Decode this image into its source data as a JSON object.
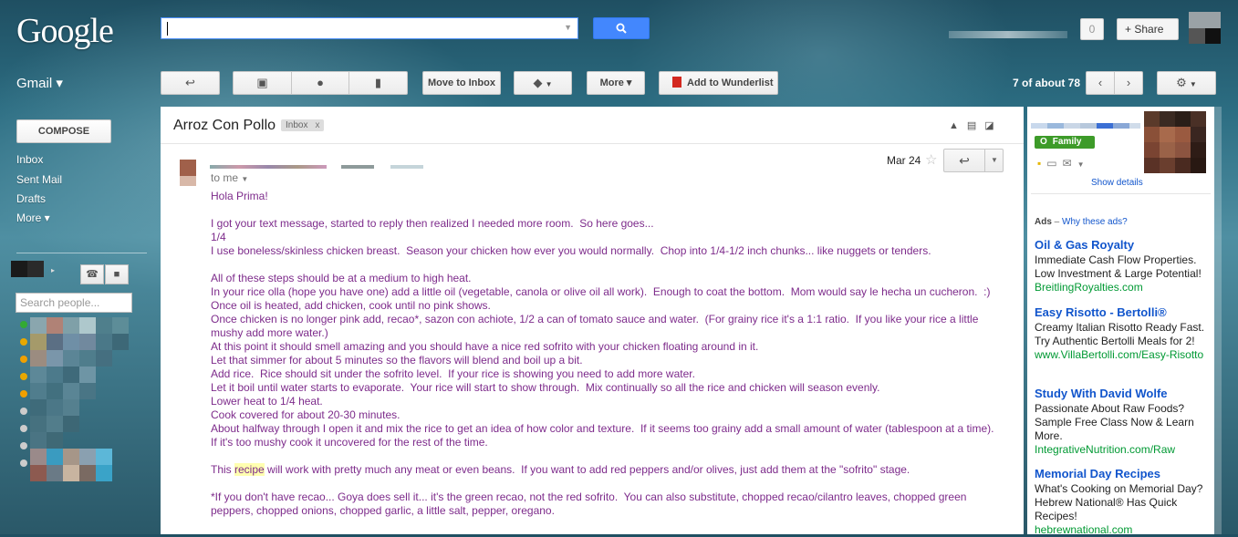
{
  "header": {
    "logo": "Google",
    "notifications_count": "0",
    "share_label": "+ Share"
  },
  "toolbar": {
    "gmail_label": "Gmail ▾",
    "move_to_inbox": "Move to Inbox",
    "more": "More ▾",
    "wunderlist": "Add to Wunderlist",
    "count_bold": "7 of about 78"
  },
  "nav": {
    "compose": "COMPOSE",
    "items": [
      "Inbox",
      "Sent Mail",
      "Drafts",
      "More ▾"
    ],
    "search_people_placeholder": "Search people..."
  },
  "message": {
    "subject": "Arroz Con Pollo",
    "label": "Inbox",
    "label_close": "x",
    "to": "to me",
    "date": "Mar 24",
    "body_before_highlight": "Hola Prima!\n\nI got your text message, started to reply then realized I needed more room.  So here goes...\n1/4\nI use boneless/skinless chicken breast.  Season your chicken how ever you would normally.  Chop into 1/4-1/2 inch chunks... like nuggets or tenders.\n\nAll of these steps should be at a medium to high heat.\nIn your rice olla (hope you have one) add a little oil (vegetable, canola or olive oil all work).  Enough to coat the bottom.  Mom would say le hecha un cucheron.  :)\nOnce oil is heated, add chicken, cook until no pink shows.\nOnce chicken is no longer pink add, recao*, sazon con achiote, 1/2 a can of tomato sauce and water.  (For grainy rice it's a 1:1 ratio.  If you like your rice a little mushy add more water.)\nAt this point it should smell amazing and you should have a nice red sofrito with your chicken floating around in it.\nLet that simmer for about 5 minutes so the flavors will blend and boil up a bit.\nAdd rice.  Rice should sit under the sofrito level.  If your rice is showing you need to add more water.\nLet it boil until water starts to evaporate.  Your rice will start to show through.  Mix continually so all the rice and chicken will season evenly.\nLower heat to 1/4 heat.\nCook covered for about 20-30 minutes.\nAbout halfway through I open it and mix the rice to get an idea of how color and texture.  If it seems too grainy add a small amount of water (tablespoon at a time).  If it's too mushy cook it uncovered for the rest of the time.\n\nThis ",
    "body_highlight": "recipe",
    "body_after_highlight": " will work with pretty much any meat or even beans.  If you want to add red peppers and/or olives, just add them at the \"sofrito\" stage.\n\n*If you don't have recao... Goya does sell it... it's the green recao, not the red sofrito.  You can also substitute, chopped recao/cilantro leaves, chopped green peppers, chopped onions, chopped garlic, a little salt, pepper, oregano."
  },
  "sidebar_right": {
    "circle": "Family",
    "show_details": "Show details",
    "ads_title": "Ads",
    "ads_dash": " – ",
    "ads_why": "Why these ads?",
    "ads": [
      {
        "title": "Oil & Gas Royalty",
        "desc": "Immediate Cash Flow Properties. Low Investment & Large Potential!",
        "url": "BreitlingRoyalties.com"
      },
      {
        "title": "Easy Risotto - Bertolli®",
        "desc": "Creamy Italian Risotto Ready Fast. Try Authentic Bertolli Meals for 2!",
        "url": "www.VillaBertolli.com/Easy-Risotto"
      },
      {
        "title": "Study With David Wolfe",
        "desc": "Passionate About Raw Foods? Sample Free Class Now & Learn More.",
        "url": "IntegrativeNutrition.com/Raw"
      },
      {
        "title": "Memorial Day Recipes",
        "desc": "What's Cooking on Memorial Day? Hebrew National® Has Quick Recipes!",
        "url": "hebrewnational.com"
      }
    ]
  },
  "colors": {
    "link": "#1155cc",
    "body_text": "#7d2b8b",
    "ad_url": "#009933",
    "family_badge": "#3d9b29",
    "search_button": "#4387fd"
  }
}
